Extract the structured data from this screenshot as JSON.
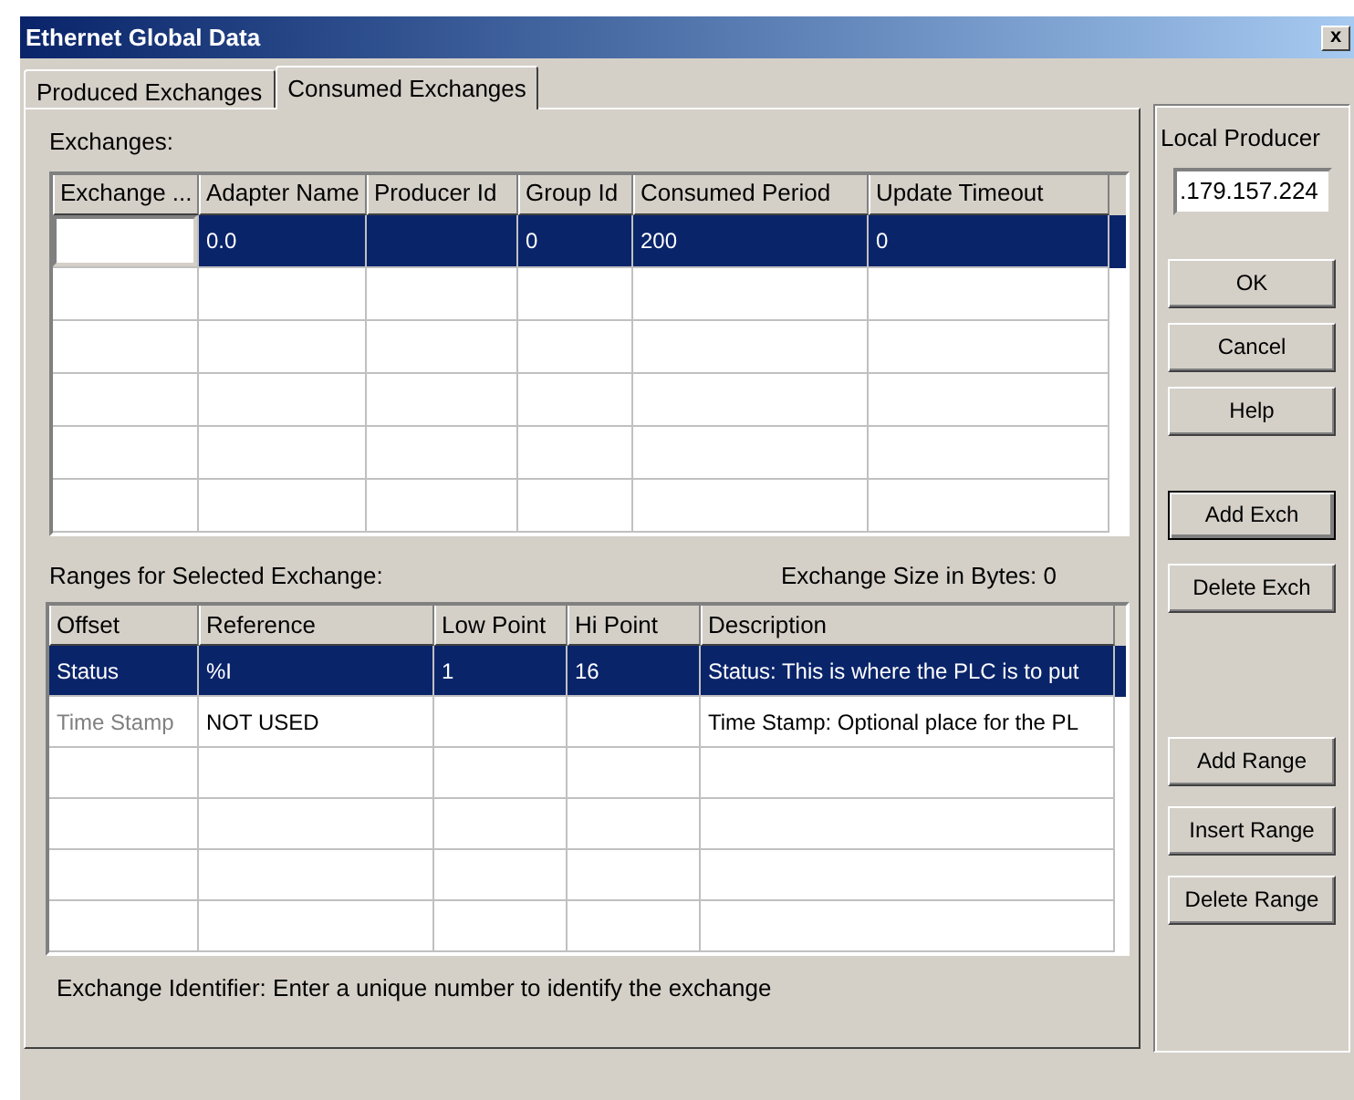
{
  "window": {
    "title": "Ethernet Global Data",
    "close": "x"
  },
  "tabs": [
    {
      "label": "Produced Exchanges",
      "selected": false
    },
    {
      "label": "Consumed Exchanges",
      "selected": true
    }
  ],
  "exchanges": {
    "label": "Exchanges:",
    "columns": [
      "Exchange ...",
      "Adapter Name",
      "Producer Id",
      "Group Id",
      "Consumed Period",
      "Update Timeout"
    ],
    "rows": [
      {
        "selected": true,
        "editing": true,
        "cells": [
          null,
          "0.0",
          null,
          "0",
          "200",
          "0"
        ]
      }
    ]
  },
  "ranges": {
    "label": "Ranges for Selected Exchange:",
    "size_text": "Exchange Size in Bytes: 0",
    "columns": [
      "Offset",
      "Reference",
      "Low Point",
      "Hi Point",
      "Description"
    ],
    "rows": [
      {
        "selected": true,
        "offset_disabled": false,
        "cells": [
          "Status",
          "%I",
          "1",
          "16",
          "Status: This is where the PLC is to put"
        ]
      },
      {
        "selected": false,
        "offset_disabled": true,
        "cells": [
          "Time Stamp",
          "NOT USED",
          null,
          null,
          "Time Stamp: Optional place for the PL"
        ]
      }
    ]
  },
  "hint": "Exchange Identifier: Enter a unique number to identify the exchange",
  "local_producer": {
    "label": "Local Producer",
    "value": ".179.157.224"
  },
  "button_groups": [
    [
      {
        "label": "OK",
        "default": false
      },
      {
        "label": "Cancel",
        "default": false
      },
      {
        "label": "Help",
        "default": false
      }
    ],
    [
      {
        "label": "Add Exch",
        "default": true
      },
      {
        "label": "Delete Exch",
        "default": false
      }
    ],
    [
      {
        "label": "Add Range",
        "default": false
      },
      {
        "label": "Insert Range",
        "default": false
      },
      {
        "label": "Delete Range",
        "default": false
      }
    ]
  ]
}
